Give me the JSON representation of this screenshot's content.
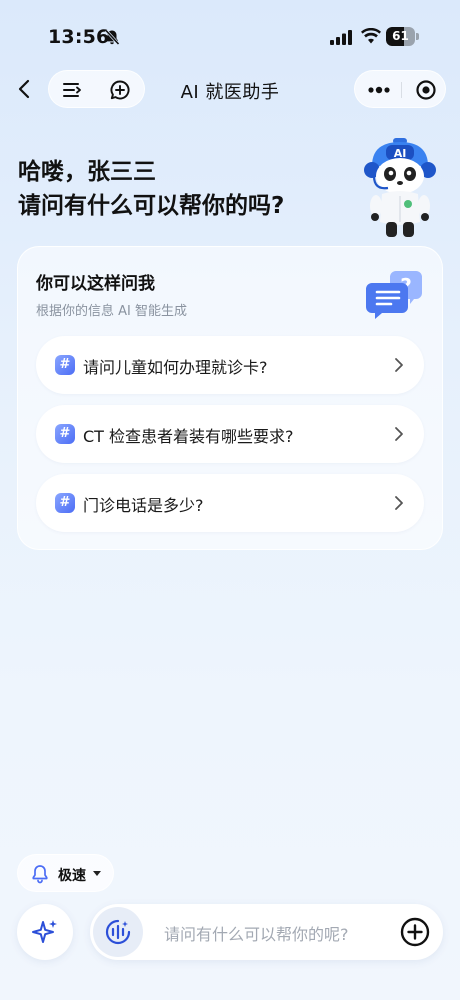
{
  "status_bar": {
    "time": "13:56",
    "battery": "61",
    "battery_level": 0.61
  },
  "nav": {
    "title": "AI 就医助手",
    "icons": [
      "back-arrow-icon",
      "list-icon",
      "chat-plus-icon",
      "more-dots-icon",
      "record-icon"
    ]
  },
  "greeting": {
    "line1": "哈喽，张三三",
    "line2": "请问有什么可以帮你的吗?"
  },
  "mascot": {
    "badge": "AI"
  },
  "suggestions": {
    "title": "你可以这样问我",
    "subtitle": "根据你的信息 AI 智能生成",
    "hash_glyph": "#",
    "items": [
      {
        "text": "请问儿童如何办理就诊卡?"
      },
      {
        "text": "CT 检查患者着装有哪些要求?"
      },
      {
        "text": "门诊电话是多少?"
      }
    ]
  },
  "speed": {
    "label": "极速"
  },
  "input": {
    "placeholder": "请问有什么可以帮你的呢?"
  },
  "colors": {
    "accent": "#4c6df5",
    "background": "#e6f0fc",
    "text": "#111111",
    "muted": "#8a93a0"
  }
}
